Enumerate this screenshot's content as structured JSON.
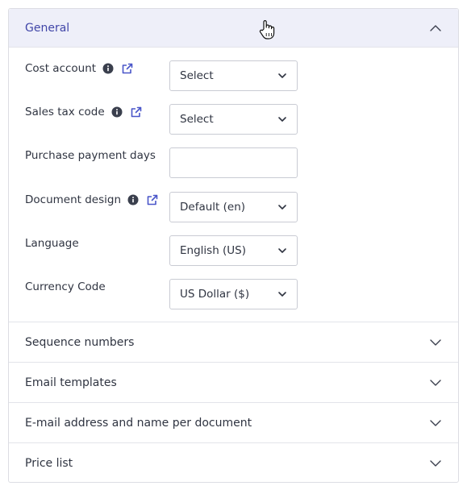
{
  "sections": {
    "general": {
      "title": "General"
    },
    "sequence": {
      "title": "Sequence numbers"
    },
    "email_templates": {
      "title": "Email templates"
    },
    "email_per_doc": {
      "title": "E-mail address and name per document"
    },
    "price_list": {
      "title": "Price list"
    }
  },
  "fields": {
    "cost_account": {
      "label": "Cost account",
      "value": "Select"
    },
    "sales_tax_code": {
      "label": "Sales tax code",
      "value": "Select"
    },
    "purchase_payment_days": {
      "label": "Purchase payment days",
      "value": ""
    },
    "document_design": {
      "label": "Document design",
      "value": "Default (en)"
    },
    "language": {
      "label": "Language",
      "value": "English (US)"
    },
    "currency_code": {
      "label": "Currency Code",
      "value": "US Dollar ($)"
    }
  },
  "colors": {
    "accent": "#4146a8",
    "header_bg": "#eeeff9",
    "border": "#dcdde3",
    "text": "#2f3441"
  },
  "icons": {
    "info": "info-icon",
    "external": "external-link-icon",
    "chevron_up": "chevron-up-icon",
    "chevron_down": "chevron-down-icon",
    "cursor": "hand-pointer-icon"
  }
}
